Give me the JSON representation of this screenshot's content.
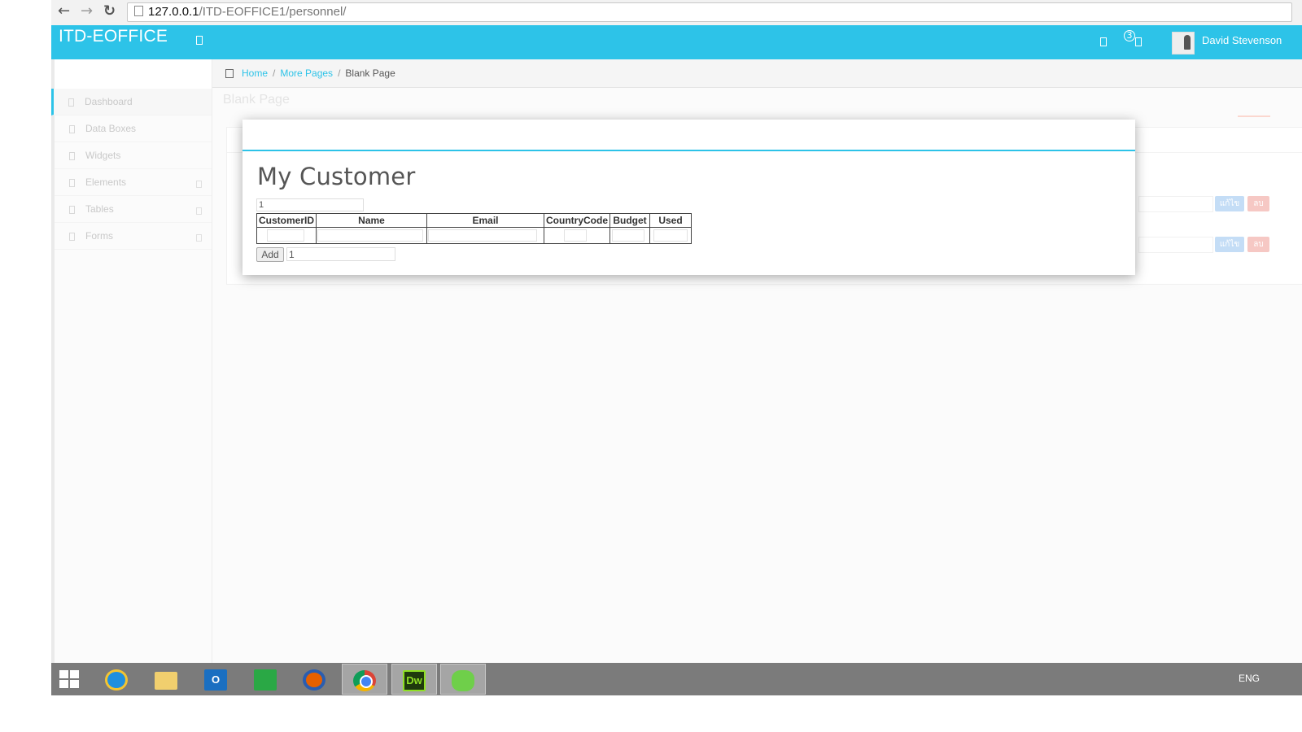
{
  "browser": {
    "back": "←",
    "forward": "→",
    "reload": "↻",
    "url_host": "127.0.0.1",
    "url_path": "/ITD-EOFFICE1/personnel/"
  },
  "header": {
    "brand": "ITD-EOFFICE",
    "notification_count": "3",
    "user_name": "David Stevenson",
    "accent_color": "#2dc3e8"
  },
  "breadcrumb": {
    "home": "Home",
    "more_pages": "More Pages",
    "current": "Blank Page",
    "separator": "/"
  },
  "sidebar": {
    "items": [
      {
        "label": "Dashboard",
        "icon": "dashboard-icon"
      },
      {
        "label": "Data Boxes",
        "icon": "grid-icon"
      },
      {
        "label": "Widgets",
        "icon": "widgets-icon"
      },
      {
        "label": "Elements",
        "icon": "elements-icon"
      },
      {
        "label": "Tables",
        "icon": "table-icon"
      },
      {
        "label": "Forms",
        "icon": "forms-icon"
      }
    ]
  },
  "page": {
    "title": "Blank Page",
    "edit_label": "แก้ไข",
    "delete_label": "ลบ"
  },
  "modal": {
    "title": "My Customer",
    "top_field_value": "1",
    "columns": [
      "CustomerID",
      "Name",
      "Email",
      "CountryCode",
      "Budget",
      "Used"
    ],
    "add_label": "Add",
    "add_field_value": "1"
  },
  "taskbar": {
    "apps": [
      "windows-start-icon",
      "internet-explorer-icon",
      "file-explorer-icon",
      "outlook-icon",
      "store-icon",
      "firefox-icon",
      "chrome-icon",
      "dreamweaver-icon",
      "clover-icon"
    ],
    "dreamweaver_label": "Dw",
    "outlook_label": "O",
    "language": "ENG"
  }
}
